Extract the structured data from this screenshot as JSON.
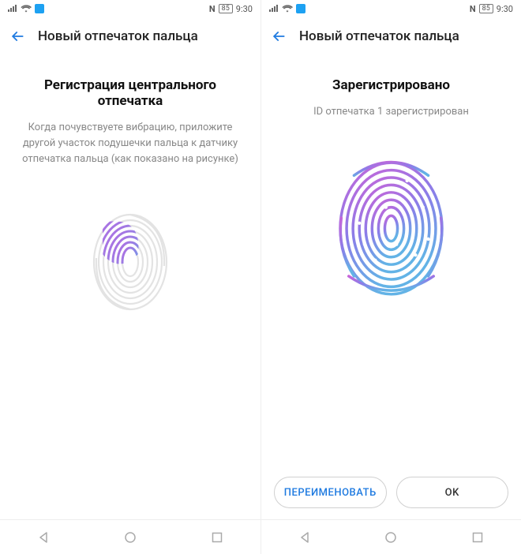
{
  "statusbar": {
    "nfc_label": "N",
    "battery_text": "85",
    "time": "9:30"
  },
  "header": {
    "title": "Новый отпечаток пальца"
  },
  "screen_left": {
    "title": "Регистрация центрального отпечатка",
    "desc": "Когда почувствуете вибрацию, приложите другой участок подушечки пальца к датчику отпечатка пальца (как показано на рисунке)"
  },
  "screen_right": {
    "title": "Зарегистрировано",
    "desc": "ID отпечатка 1 зарегистрирован",
    "rename_button": "ПЕРЕИМЕНОВАТЬ",
    "ok_button": "OK"
  }
}
